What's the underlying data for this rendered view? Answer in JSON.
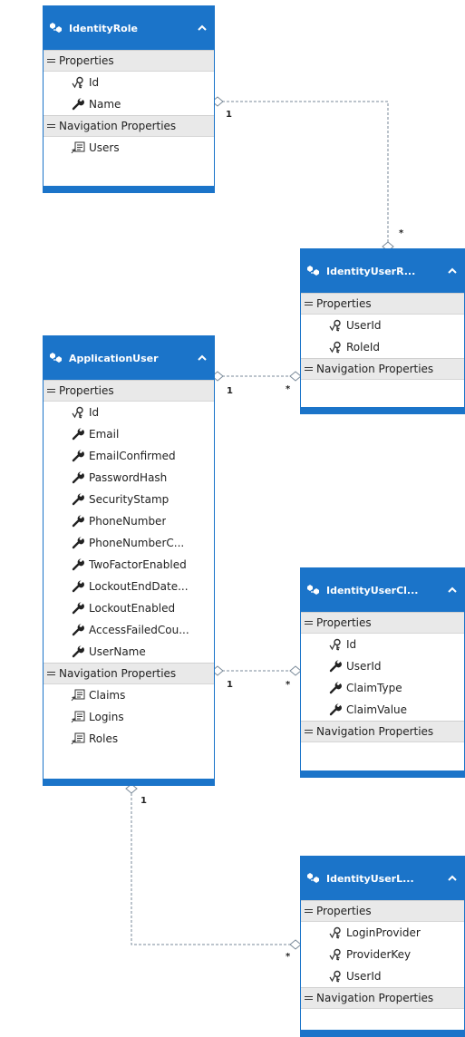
{
  "colors": {
    "accent": "#1b74c9",
    "section_bg": "#e9e9e9",
    "connector": "#7a8a99"
  },
  "entities": {
    "identity_role": {
      "title": "IdentityRole",
      "properties_label": "Properties",
      "properties": [
        {
          "name": "Id",
          "icon": "key-icon"
        },
        {
          "name": "Name",
          "icon": "wrench-icon"
        }
      ],
      "nav_label": "Navigation Properties",
      "navigation": [
        {
          "name": "Users",
          "icon": "navigation-icon"
        }
      ]
    },
    "identity_user_role": {
      "title": "IdentityUserR...",
      "properties_label": "Properties",
      "properties": [
        {
          "name": "UserId",
          "icon": "key-icon"
        },
        {
          "name": "RoleId",
          "icon": "key-icon"
        }
      ],
      "nav_label": "Navigation Properties"
    },
    "application_user": {
      "title": "ApplicationUser",
      "properties_label": "Properties",
      "properties": [
        {
          "name": "Id",
          "icon": "key-icon"
        },
        {
          "name": "Email",
          "icon": "wrench-icon"
        },
        {
          "name": "EmailConfirmed",
          "icon": "wrench-icon"
        },
        {
          "name": "PasswordHash",
          "icon": "wrench-icon"
        },
        {
          "name": "SecurityStamp",
          "icon": "wrench-icon"
        },
        {
          "name": "PhoneNumber",
          "icon": "wrench-icon"
        },
        {
          "name": "PhoneNumberC...",
          "icon": "wrench-icon"
        },
        {
          "name": "TwoFactorEnabled",
          "icon": "wrench-icon"
        },
        {
          "name": "LockoutEndDate...",
          "icon": "wrench-icon"
        },
        {
          "name": "LockoutEnabled",
          "icon": "wrench-icon"
        },
        {
          "name": "AccessFailedCou...",
          "icon": "wrench-icon"
        },
        {
          "name": "UserName",
          "icon": "wrench-icon"
        }
      ],
      "nav_label": "Navigation Properties",
      "navigation": [
        {
          "name": "Claims",
          "icon": "navigation-icon"
        },
        {
          "name": "Logins",
          "icon": "navigation-icon"
        },
        {
          "name": "Roles",
          "icon": "navigation-icon"
        }
      ]
    },
    "identity_user_claim": {
      "title": "IdentityUserCl...",
      "properties_label": "Properties",
      "properties": [
        {
          "name": "Id",
          "icon": "key-icon"
        },
        {
          "name": "UserId",
          "icon": "wrench-icon"
        },
        {
          "name": "ClaimType",
          "icon": "wrench-icon"
        },
        {
          "name": "ClaimValue",
          "icon": "wrench-icon"
        }
      ],
      "nav_label": "Navigation Properties"
    },
    "identity_user_login": {
      "title": "IdentityUserL...",
      "properties_label": "Properties",
      "properties": [
        {
          "name": "LoginProvider",
          "icon": "key-icon"
        },
        {
          "name": "ProviderKey",
          "icon": "key-icon"
        },
        {
          "name": "UserId",
          "icon": "key-icon"
        }
      ],
      "nav_label": "Navigation Properties"
    }
  },
  "associations": [
    {
      "from": "IdentityRole",
      "to": "IdentityUserRole",
      "from_mult": "1",
      "to_mult": "*"
    },
    {
      "from": "ApplicationUser",
      "to": "IdentityUserRole",
      "from_mult": "1",
      "to_mult": "*"
    },
    {
      "from": "ApplicationUser",
      "to": "IdentityUserClaim",
      "from_mult": "1",
      "to_mult": "*"
    },
    {
      "from": "ApplicationUser",
      "to": "IdentityUserLogin",
      "from_mult": "1",
      "to_mult": "*"
    }
  ]
}
